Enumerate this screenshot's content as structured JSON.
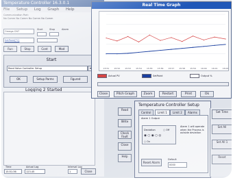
{
  "app": {
    "title": "Temperature Controller 16.3.0.1",
    "menu": [
      "File",
      "Setup",
      "Log",
      "Graph",
      "Help"
    ],
    "connection": [
      "Communication Port:",
      "No Comm  No Comm  No Comm  No Comm"
    ],
    "device_field": "Omega CN7",
    "setpoint_field": "SetPoint[°C]",
    "small_labels": [
      "Start",
      "Stop",
      "Alarm"
    ],
    "buttons_row": [
      "Run",
      "Stop",
      "Cont",
      "Mod"
    ],
    "panel": {
      "title": "Start",
      "select_value": "Read Value Controller Setup",
      "buttons": [
        "OK",
        "Setup Parms",
        "Figured"
      ]
    },
    "logging_label": "Logging 2 Started",
    "bottom": {
      "time_label": "Time",
      "time_value": "15:51:36",
      "value_label": "Actual Log",
      "value_value": "123.45",
      "interval_label": "Interval Log",
      "interval_value": "1",
      "close_label": "Close"
    }
  },
  "graph": {
    "title": "Real Time Graph",
    "legend": [
      "Actual PV",
      "SetPoint",
      "Output %"
    ],
    "buttons": [
      "Close",
      "Pitch Graph",
      "Zoom",
      "Restart",
      "Print",
      "Ok"
    ]
  },
  "controller": {
    "title": "Temperature Controller Setup",
    "tabs": [
      "Control",
      "Limit 1",
      "Limit 2",
      "Alarms"
    ],
    "tab_text": "Alarm 1 Output",
    "radio_label": "Deviation",
    "radio_options": [
      "Off",
      "On"
    ],
    "note": "Alarm 1 will operate when the Process is outside deviation",
    "reset_button": "Reset Alarm",
    "value_label": "Default",
    "value": "0000",
    "side_buttons": [
      "Read",
      "Write",
      "Check Fault",
      "Close",
      "Help"
    ],
    "right_buttons": [
      "Set Time",
      "Set All",
      "Set All 1",
      "Reset"
    ]
  },
  "chart_data": {
    "type": "line",
    "title": "Real Time Graph",
    "xlabel": "",
    "ylabel": "",
    "x": [
      "15:51",
      "15:52",
      "15:53",
      "15:54",
      "15:55",
      "15:56",
      "15:57",
      "15:58",
      "15:59",
      "16:00",
      "16:01",
      "16:02"
    ],
    "series": [
      {
        "name": "Actual PV",
        "color": "#d64545",
        "values": [
          52,
          46,
          55,
          44,
          58,
          47,
          53,
          45,
          56,
          48,
          54,
          50
        ]
      },
      {
        "name": "SetPoint",
        "color": "#1a3fa0",
        "values": [
          20,
          20,
          21,
          23,
          25,
          27,
          29,
          31,
          33,
          35,
          37,
          39
        ]
      }
    ],
    "ylim": [
      0,
      100
    ],
    "grid": true,
    "legend": "bottom"
  }
}
